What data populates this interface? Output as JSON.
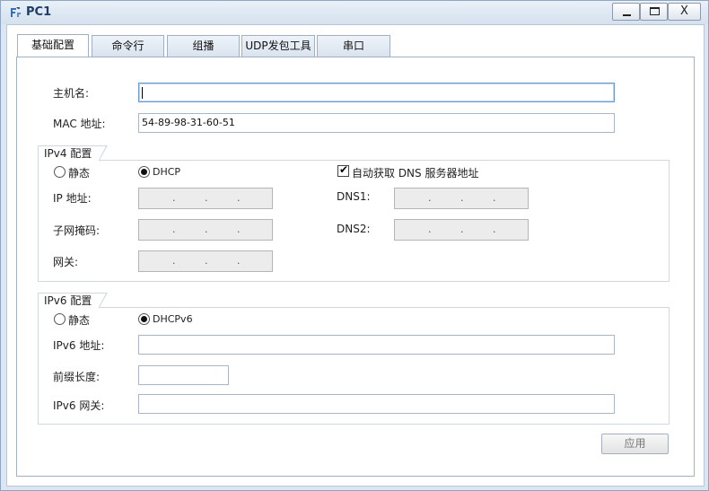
{
  "window": {
    "title": "PC1",
    "minimize": "_",
    "maximize": "□",
    "close": "X"
  },
  "tabs": [
    {
      "label": "基础配置",
      "active": true
    },
    {
      "label": "命令行",
      "active": false
    },
    {
      "label": "组播",
      "active": false
    },
    {
      "label": "UDP发包工具",
      "active": false
    },
    {
      "label": "串口",
      "active": false
    }
  ],
  "basic": {
    "hostname_label": "主机名:",
    "hostname_value": "",
    "mac_label": "MAC 地址:",
    "mac_value": "54-89-98-31-60-51"
  },
  "ipv4": {
    "group_title": "IPv4 配置",
    "static_label": "静态",
    "dhcp_label": "DHCP",
    "dhcp_selected": true,
    "ip_label": "IP 地址:",
    "mask_label": "子网掩码:",
    "gateway_label": "网关:",
    "auto_dns_label": "自动获取 DNS 服务器地址",
    "auto_dns_checked": true,
    "dns1_label": "DNS1:",
    "dns2_label": "DNS2:",
    "ip_dots": ".",
    "check_glyph": "✔"
  },
  "ipv6": {
    "group_title": "IPv6 配置",
    "static_label": "静态",
    "dhcp_label": "DHCPv6",
    "dhcp_selected": true,
    "ip_label": "IPv6 地址:",
    "prefix_label": "前缀长度:",
    "gateway_label": "IPv6 网关:",
    "ip_value": "",
    "prefix_value": "",
    "gateway_value": ""
  },
  "actions": {
    "apply_label": "应用"
  },
  "colors": {
    "accent": "#1d3d66",
    "disabled_field": "#ececec"
  }
}
